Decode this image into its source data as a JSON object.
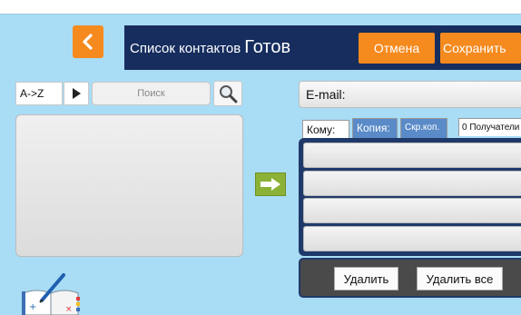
{
  "header": {
    "back_icon": "chevron-left-icon",
    "title": "Список контактов",
    "status": "Готов",
    "cancel_label": "Отмена",
    "save_label": "Сохранить"
  },
  "left_pane": {
    "sort_label": "A->Z",
    "play_icon": "play-icon",
    "search_placeholder": "Поиск",
    "search_icon": "magnifier-icon",
    "contacts": [],
    "move_icon": "arrow-right-icon",
    "notebook_icon": "address-book-icon"
  },
  "right_pane": {
    "email_label": "E-mail:",
    "tabs": {
      "to": "Кому:",
      "cc": "Копия:",
      "bcc": "Скр.коп.",
      "count": "0 Получатели"
    },
    "recipients": [
      "",
      "",
      "",
      ""
    ],
    "delete_label": "Удалить",
    "delete_all_label": "Удалить все"
  },
  "colors": {
    "background": "#a9dcf5",
    "accent_orange": "#f58a1f",
    "navy": "#162d5e",
    "green": "#8bb237",
    "tab_blue": "#5a8bc8"
  }
}
